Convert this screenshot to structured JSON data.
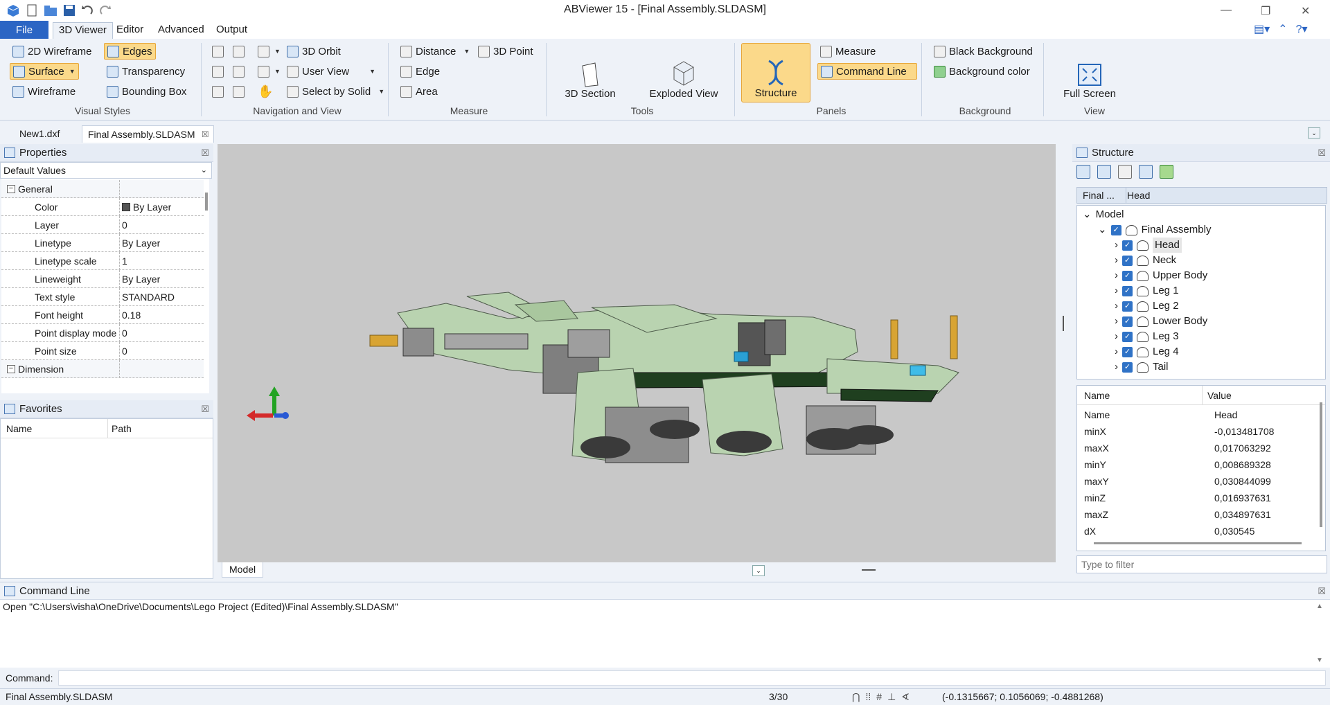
{
  "window": {
    "title": "ABViewer 15 - [Final Assembly.SLDASM]"
  },
  "ribbon_tabs": [
    "File",
    "3D Viewer",
    "Editor",
    "Advanced",
    "Output"
  ],
  "visual_styles": {
    "group_label": "Visual Styles",
    "wireframe2d": "2D Wireframe",
    "edges": "Edges",
    "surface": "Surface",
    "transparency": "Transparency",
    "wireframe": "Wireframe",
    "bounding_box": "Bounding Box"
  },
  "navigation": {
    "group_label": "Navigation and View",
    "orbit": "3D Orbit",
    "user_view": "User View",
    "select_by_solid": "Select by Solid"
  },
  "measure": {
    "group_label": "Measure",
    "distance": "Distance",
    "point3d": "3D Point",
    "edge": "Edge",
    "area": "Area"
  },
  "tools": {
    "group_label": "Tools",
    "section": "3D Section",
    "exploded": "Exploded View"
  },
  "panels": {
    "group_label": "Panels",
    "structure": "Structure",
    "measure": "Measure",
    "command_line": "Command Line"
  },
  "background": {
    "group_label": "Background",
    "black": "Black Background",
    "color": "Background color"
  },
  "view": {
    "group_label": "View",
    "full_screen": "Full Screen"
  },
  "doc_tabs": [
    "New1.dxf",
    "Final Assembly.SLDASM"
  ],
  "properties": {
    "title": "Properties",
    "dropdown": "Default Values",
    "category_general": "General",
    "rows": [
      {
        "k": "Color",
        "v": "By Layer"
      },
      {
        "k": "Layer",
        "v": "0"
      },
      {
        "k": "Linetype",
        "v": "By Layer"
      },
      {
        "k": "Linetype scale",
        "v": "1"
      },
      {
        "k": "Lineweight",
        "v": "By Layer"
      },
      {
        "k": "Text style",
        "v": "STANDARD"
      },
      {
        "k": "Font height",
        "v": "0.18"
      },
      {
        "k": "Point display mode",
        "v": "0"
      },
      {
        "k": "Point size",
        "v": "0"
      }
    ],
    "category_dimension": "Dimension"
  },
  "favorites": {
    "title": "Favorites",
    "col_name": "Name",
    "col_path": "Path"
  },
  "viewport": {
    "layout_tab": "Model"
  },
  "structure": {
    "title": "Structure",
    "crumb1": "Final ...",
    "crumb2": "Head",
    "root": "Model",
    "assembly": "Final Assembly",
    "items": [
      "Head",
      "Neck",
      "Upper Body",
      "Leg 1",
      "Leg 2",
      "Lower Body",
      "Leg 3",
      "Leg 4",
      "Tail"
    ],
    "col_name": "Name",
    "col_value": "Value",
    "props": [
      {
        "k": "Name",
        "v": "Head"
      },
      {
        "k": "minX",
        "v": "-0,013481708"
      },
      {
        "k": "maxX",
        "v": "0,017063292"
      },
      {
        "k": "minY",
        "v": "0,008689328"
      },
      {
        "k": "maxY",
        "v": "0,030844099"
      },
      {
        "k": "minZ",
        "v": "0,016937631"
      },
      {
        "k": "maxZ",
        "v": "0,034897631"
      },
      {
        "k": "dX",
        "v": "0,030545"
      }
    ],
    "filter_placeholder": "Type to filter"
  },
  "command_line": {
    "title": "Command Line",
    "output": "Open \"C:\\Users\\visha\\OneDrive\\Documents\\Lego Project (Edited)\\Final Assembly.SLDASM\"",
    "prompt": "Command:"
  },
  "status": {
    "file": "Final Assembly.SLDASM",
    "page": "3/30",
    "coords": "(-0.1315667; 0.1056069; -0.4881268)"
  }
}
